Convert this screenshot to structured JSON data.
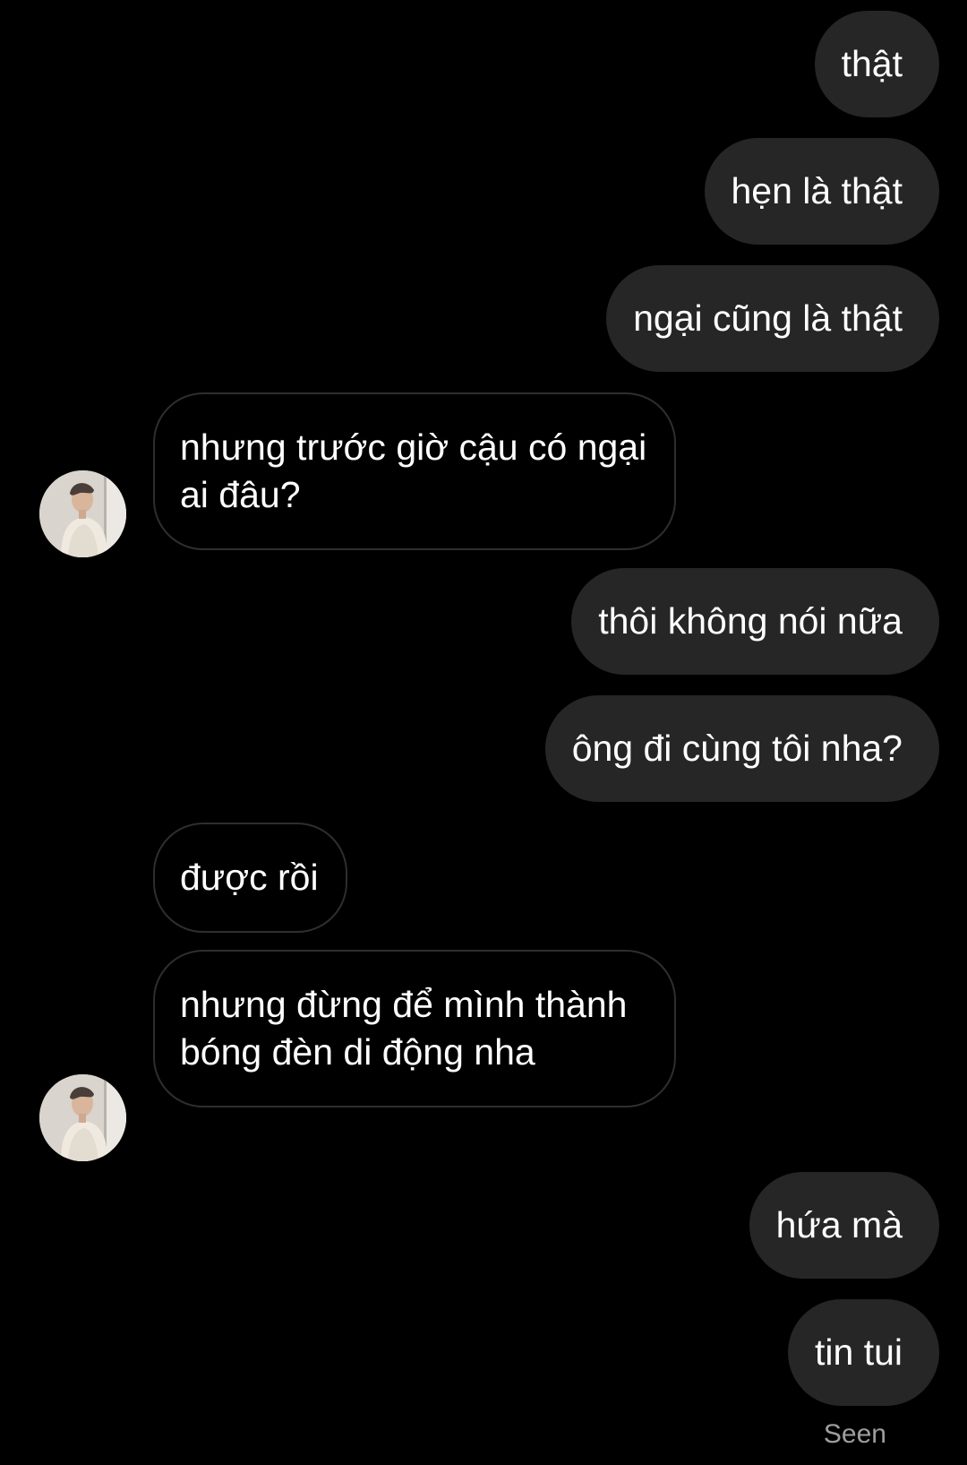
{
  "conversation": {
    "messages": [
      {
        "direction": "sent",
        "text": "thật"
      },
      {
        "direction": "sent",
        "text": "hẹn là thật"
      },
      {
        "direction": "sent",
        "text": "ngại cũng là thật"
      },
      {
        "direction": "received",
        "text": "nhưng trước giờ cậu có ngại ai đâu?"
      },
      {
        "direction": "sent",
        "text": "thôi không nói nữa"
      },
      {
        "direction": "sent",
        "text": "ông đi cùng tôi nha?"
      },
      {
        "direction": "received",
        "text": "được rồi"
      },
      {
        "direction": "received",
        "text": "nhưng đừng để mình thành bóng đèn di động nha"
      },
      {
        "direction": "sent",
        "text": "hứa mà"
      },
      {
        "direction": "sent",
        "text": "tin tui"
      }
    ],
    "status": "Seen"
  },
  "colors": {
    "background": "#000000",
    "sent_bubble": "#262626",
    "received_border": "#2e2e2e",
    "text": "#ffffff",
    "status_text": "#9e9e9e"
  },
  "icons": {
    "avatar": "contact-avatar-photo"
  }
}
